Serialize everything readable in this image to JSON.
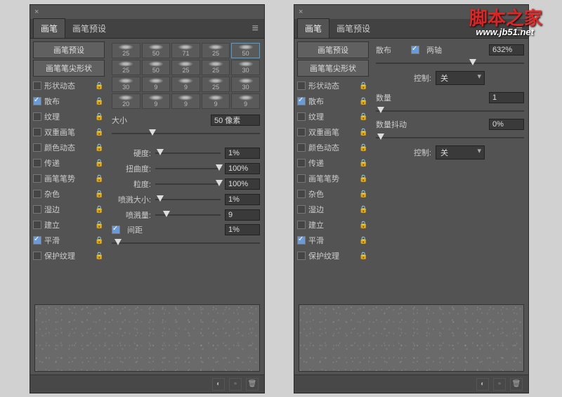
{
  "watermark": {
    "main": "脚本之家",
    "url": "www.jb51.net"
  },
  "tabs": {
    "brush": "画笔",
    "preset": "画笔预设"
  },
  "side": {
    "preset_btn": "画笔预设",
    "tip_btn": "画笔笔尖形状",
    "items": [
      {
        "label": "形状动态",
        "checked": false,
        "lock": true
      },
      {
        "label": "散布",
        "checked": true,
        "lock": true
      },
      {
        "label": "纹理",
        "checked": false,
        "lock": true
      },
      {
        "label": "双重画笔",
        "checked": false,
        "lock": true
      },
      {
        "label": "颜色动态",
        "checked": false,
        "lock": true
      },
      {
        "label": "传递",
        "checked": false,
        "lock": true
      },
      {
        "label": "画笔笔势",
        "checked": false,
        "lock": true
      },
      {
        "label": "杂色",
        "checked": false,
        "lock": true
      },
      {
        "label": "湿边",
        "checked": false,
        "lock": true
      },
      {
        "label": "建立",
        "checked": false,
        "lock": true
      },
      {
        "label": "平滑",
        "checked": true,
        "lock": true
      },
      {
        "label": "保护纹理",
        "checked": false,
        "lock": true
      }
    ]
  },
  "left": {
    "brush_sizes": [
      [
        "25",
        "50",
        "71",
        "25",
        "50"
      ],
      [
        "25",
        "50",
        "25",
        "25",
        "30"
      ],
      [
        "30",
        "9",
        "9",
        "25",
        "30"
      ],
      [
        "20",
        "9",
        "9",
        "9",
        "9"
      ]
    ],
    "selected_brush": "50",
    "size_label": "大小",
    "size_value": "50 像素",
    "hardness_label": "硬度:",
    "hardness_value": "1%",
    "distort_label": "扭曲度:",
    "distort_value": "100%",
    "grain_label": "粒度:",
    "grain_value": "100%",
    "splash_size_label": "喷溅大小:",
    "splash_size_value": "1%",
    "splash_amt_label": "喷溅量:",
    "splash_amt_value": "9",
    "spacing_label": "间距",
    "spacing_checked": true,
    "spacing_value": "1%"
  },
  "right": {
    "scatter_label": "散布",
    "both_axes_label": "两轴",
    "both_axes_checked": true,
    "scatter_value": "632%",
    "control_label": "控制:",
    "control_value": "关",
    "count_label": "数量",
    "count_value": "1",
    "jitter_label": "数量抖动",
    "jitter_value": "0%",
    "control2_label": "控制:",
    "control2_value": "关"
  },
  "icons": {
    "close": "×",
    "menu": "≡",
    "lock": "🔒",
    "toggle": "◐",
    "new": "▫",
    "trash": "🗑"
  }
}
